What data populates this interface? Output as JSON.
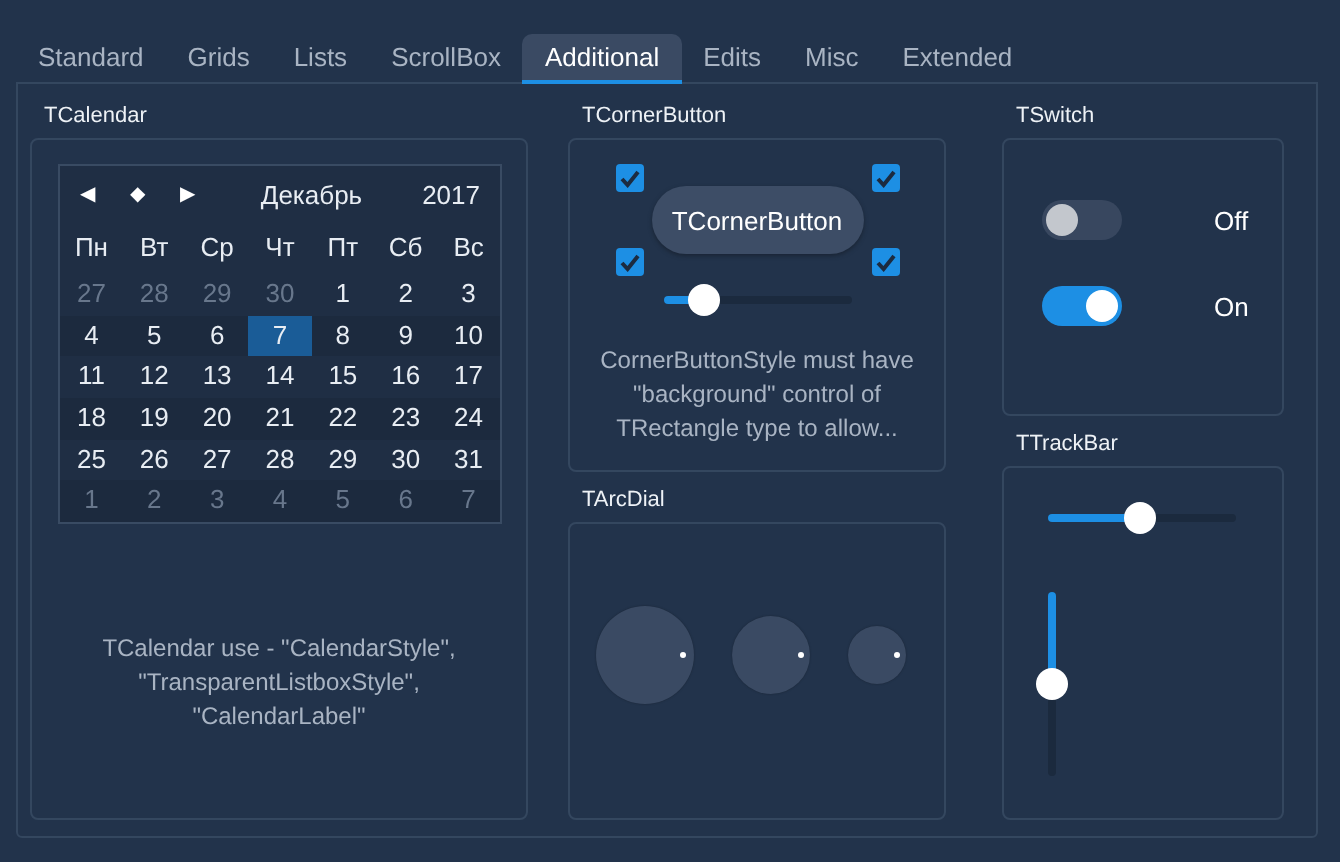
{
  "tabs": [
    {
      "label": "Standard",
      "selected": false
    },
    {
      "label": "Grids",
      "selected": false
    },
    {
      "label": "Lists",
      "selected": false
    },
    {
      "label": "ScrollBox",
      "selected": false
    },
    {
      "label": "Additional",
      "selected": true
    },
    {
      "label": "Edits",
      "selected": false
    },
    {
      "label": "Misc",
      "selected": false
    },
    {
      "label": "Extended",
      "selected": false
    }
  ],
  "calendar_group": {
    "title": "TCalendar",
    "calendar": {
      "nav": [
        "◀",
        "◆",
        "▶"
      ],
      "month": "Декабрь",
      "year": "2017",
      "weekdays": [
        "Пн",
        "Вт",
        "Ср",
        "Чт",
        "Пт",
        "Сб",
        "Вс"
      ],
      "weeks": [
        [
          {
            "day": "27",
            "muted": true,
            "selected": false
          },
          {
            "day": "28",
            "muted": true,
            "selected": false
          },
          {
            "day": "29",
            "muted": true,
            "selected": false
          },
          {
            "day": "30",
            "muted": true,
            "selected": false
          },
          {
            "day": "1",
            "muted": false,
            "selected": false
          },
          {
            "day": "2",
            "muted": false,
            "selected": false
          },
          {
            "day": "3",
            "muted": false,
            "selected": false
          }
        ],
        [
          {
            "day": "4",
            "muted": false,
            "selected": false
          },
          {
            "day": "5",
            "muted": false,
            "selected": false
          },
          {
            "day": "6",
            "muted": false,
            "selected": false
          },
          {
            "day": "7",
            "muted": false,
            "selected": true
          },
          {
            "day": "8",
            "muted": false,
            "selected": false
          },
          {
            "day": "9",
            "muted": false,
            "selected": false
          },
          {
            "day": "10",
            "muted": false,
            "selected": false
          }
        ],
        [
          {
            "day": "11",
            "muted": false,
            "selected": false
          },
          {
            "day": "12",
            "muted": false,
            "selected": false
          },
          {
            "day": "13",
            "muted": false,
            "selected": false
          },
          {
            "day": "14",
            "muted": false,
            "selected": false
          },
          {
            "day": "15",
            "muted": false,
            "selected": false
          },
          {
            "day": "16",
            "muted": false,
            "selected": false
          },
          {
            "day": "17",
            "muted": false,
            "selected": false
          }
        ],
        [
          {
            "day": "18",
            "muted": false,
            "selected": false
          },
          {
            "day": "19",
            "muted": false,
            "selected": false
          },
          {
            "day": "20",
            "muted": false,
            "selected": false
          },
          {
            "day": "21",
            "muted": false,
            "selected": false
          },
          {
            "day": "22",
            "muted": false,
            "selected": false
          },
          {
            "day": "23",
            "muted": false,
            "selected": false
          },
          {
            "day": "24",
            "muted": false,
            "selected": false
          }
        ],
        [
          {
            "day": "25",
            "muted": false,
            "selected": false
          },
          {
            "day": "26",
            "muted": false,
            "selected": false
          },
          {
            "day": "27",
            "muted": false,
            "selected": false
          },
          {
            "day": "28",
            "muted": false,
            "selected": false
          },
          {
            "day": "29",
            "muted": false,
            "selected": false
          },
          {
            "day": "30",
            "muted": false,
            "selected": false
          },
          {
            "day": "31",
            "muted": false,
            "selected": false
          }
        ],
        [
          {
            "day": "1",
            "muted": true,
            "selected": false
          },
          {
            "day": "2",
            "muted": true,
            "selected": false
          },
          {
            "day": "3",
            "muted": true,
            "selected": false
          },
          {
            "day": "4",
            "muted": true,
            "selected": false
          },
          {
            "day": "5",
            "muted": true,
            "selected": false
          },
          {
            "day": "6",
            "muted": true,
            "selected": false
          },
          {
            "day": "7",
            "muted": true,
            "selected": false
          }
        ]
      ]
    },
    "note": "TCalendar use - \"CalendarStyle\", \"TransparentListboxStyle\", \"CalendarLabel\""
  },
  "corner_group": {
    "title": "TCornerButton",
    "corners": [
      {
        "checked": true
      },
      {
        "checked": true
      },
      {
        "checked": true
      },
      {
        "checked": true
      }
    ],
    "button": "TCornerButton",
    "slider": {
      "level": 0.22
    },
    "note": "CornerButtonStyle must have \"background\" control of TRectangle type to allow..."
  },
  "arcdial_group": {
    "title": "TArcDial"
  },
  "switch_group": {
    "title": "TSwitch",
    "switches": [
      {
        "on": false,
        "label": "Off"
      },
      {
        "on": true,
        "label": "On"
      }
    ]
  },
  "trackbar_group": {
    "title": "TTrackBar",
    "horizontal": {
      "level": 0.49
    },
    "vertical": {
      "level": 0.5
    }
  }
}
